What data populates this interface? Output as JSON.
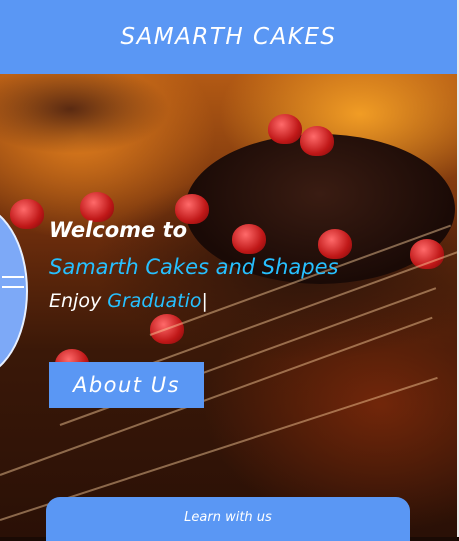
{
  "header": {
    "title": "SAMARTH CAKES"
  },
  "hero": {
    "welcome": "Welcome to",
    "subtitle": "Samarth Cakes and Shapes",
    "enjoy_prefix": "Enjoy ",
    "typed_text": "Graduatio",
    "cursor": "|",
    "about_button": "About Us"
  },
  "learn": {
    "label": "Learn with us"
  },
  "colors": {
    "accent": "#5a97f4",
    "highlight": "#27c0ff"
  }
}
